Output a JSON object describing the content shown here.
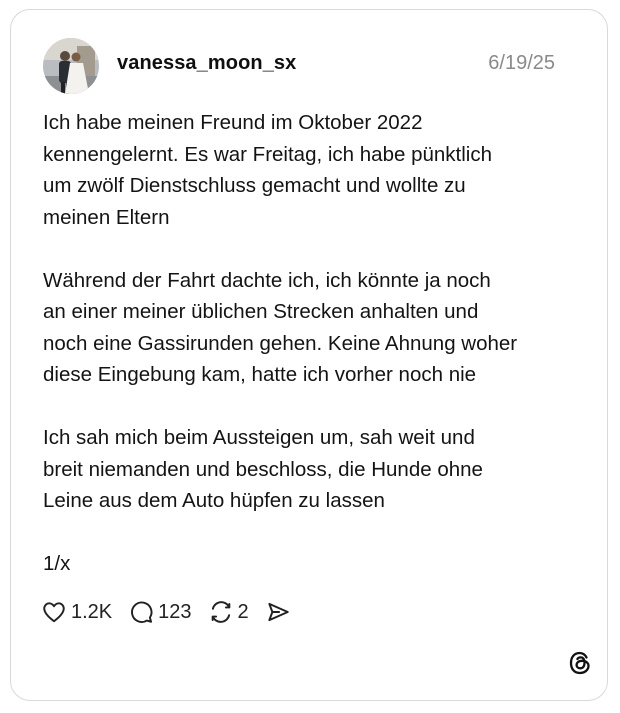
{
  "post": {
    "username": "vanessa_moon_sx",
    "date": "6/19/25",
    "paragraphs": [
      "Ich habe meinen Freund im Oktober 2022\nkennengelernt. Es war Freitag, ich habe pünktlich\num zwölf Dienstschluss gemacht und wollte zu\nmeinen Eltern",
      "Während der Fahrt dachte ich, ich könnte ja noch\nan einer meiner üblichen Strecken anhalten und\nnoch eine Gassirunden gehen. Keine Ahnung woher\ndiese Eingebung kam, hatte ich vorher noch nie",
      "Ich sah mich beim Aussteigen um, sah weit und\nbreit niemanden und beschloss, die Hunde ohne\nLeine aus dem Auto hüpfen zu lassen"
    ],
    "thread_counter": "1/x"
  },
  "actions": {
    "likes": "1.2K",
    "replies": "123",
    "reposts": "2"
  },
  "icons": {
    "like": "heart-icon",
    "reply": "speech-bubble-icon",
    "repost": "repost-arrows-icon",
    "share": "send-icon",
    "brand": "threads-logo-icon"
  }
}
